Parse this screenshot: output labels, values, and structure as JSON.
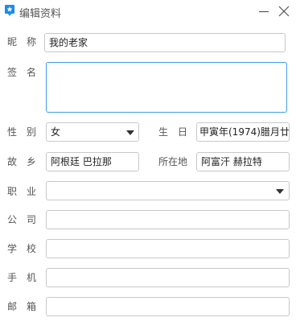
{
  "window": {
    "title": "编辑资料",
    "icon": "qq-penguin-icon",
    "accent_color": "#1a8cf0",
    "focus_color": "#3f9ee8"
  },
  "form": {
    "nickname": {
      "label": "昵称",
      "value": "我的老家"
    },
    "signature": {
      "label": "签名",
      "value": ""
    },
    "gender": {
      "label": "性别",
      "value": "女"
    },
    "birthday": {
      "label": "生日",
      "value": "甲寅年(1974)腊月廿"
    },
    "hometown": {
      "label": "故乡",
      "value": "阿根廷 巴拉那"
    },
    "location": {
      "label": "所在地",
      "value": "阿富汗 赫拉特"
    },
    "occupation": {
      "label": "职业",
      "value": ""
    },
    "company": {
      "label": "公司",
      "value": ""
    },
    "school": {
      "label": "学校",
      "value": ""
    },
    "phone": {
      "label": "手机",
      "value": ""
    },
    "email": {
      "label": "邮箱",
      "value": ""
    }
  }
}
